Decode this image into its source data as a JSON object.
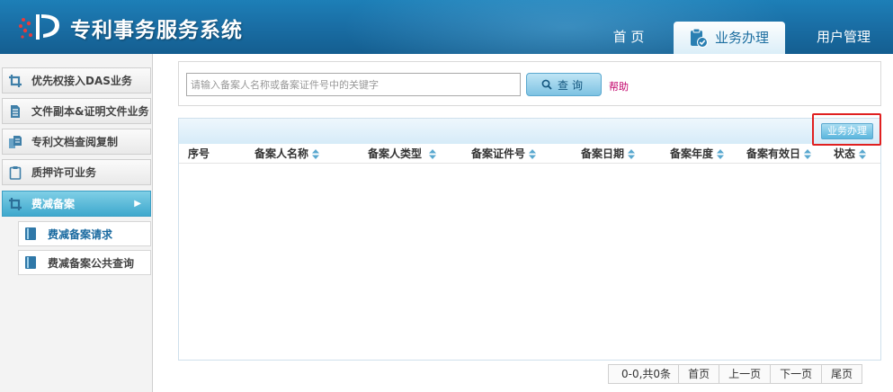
{
  "header": {
    "title": "专利事务服务系统",
    "nav": {
      "home": "首 页",
      "business": "业务办理",
      "user_admin": "用户管理"
    }
  },
  "sidebar": {
    "items": [
      {
        "label": "优先权接入DAS业务",
        "icon": "crop-icon"
      },
      {
        "label": "文件副本&证明文件业务",
        "icon": "document-icon"
      },
      {
        "label": "专利文档查阅复制",
        "icon": "document-copy-icon"
      },
      {
        "label": "质押许可业务",
        "icon": "clipboard-icon"
      },
      {
        "label": "费减备案",
        "icon": "crop-icon",
        "arrow": "▶"
      }
    ],
    "subitems": [
      {
        "label": "费减备案请求",
        "icon": "book-icon"
      },
      {
        "label": "费减备案公共查询",
        "icon": "book-icon"
      }
    ]
  },
  "search": {
    "placeholder": "请输入备案人名称或备案证件号中的关键字",
    "value": "",
    "button_label": "查询",
    "help_label": "帮助"
  },
  "grid": {
    "toolbar_button": "业务办理",
    "columns": [
      "序号",
      "备案人名称",
      "备案人类型",
      "备案证件号",
      "备案日期",
      "备案年度",
      "备案有效日",
      "状态"
    ],
    "rows": []
  },
  "pager": {
    "summary": "0-0,共0条",
    "first": "首页",
    "prev": "上一页",
    "next": "下一页",
    "last": "尾页"
  },
  "colors": {
    "header_blue": "#1a6fa6",
    "active_tab_text": "#1c6ea0",
    "sidebar_active": "#3ea8cd",
    "help_link": "#c2006a",
    "highlight": "#e02020"
  }
}
